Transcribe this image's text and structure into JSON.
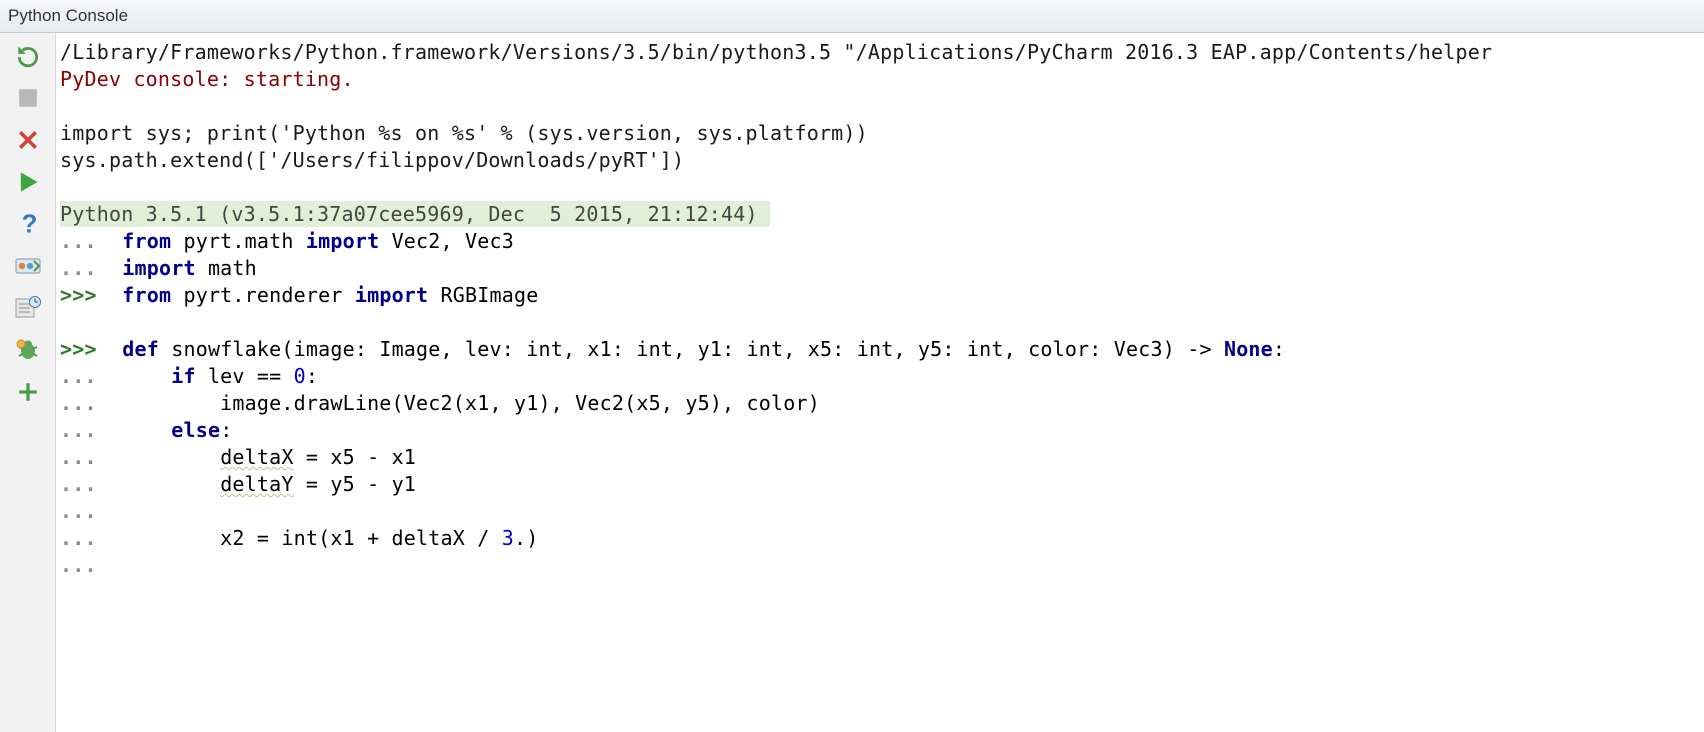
{
  "header": {
    "title": "Python Console"
  },
  "console": {
    "line1": "/Library/Frameworks/Python.framework/Versions/3.5/bin/python3.5 \"/Applications/PyCharm 2016.3 EAP.app/Contents/helper",
    "line2": "PyDev console: starting.",
    "line4": "import sys; print('Python %s on %s' % (sys.version, sys.platform))",
    "line5": "sys.path.extend(['/Users/filippov/Downloads/pyRT'])",
    "line7": "Python 3.5.1 (v3.5.1:37a07cee5969, Dec  5 2015, 21:12:44) ",
    "p_cont": "...",
    "p_main": ">>>",
    "kw_from": "from",
    "kw_import": "import",
    "kw_def": "def",
    "kw_if": "if",
    "kw_else": "else",
    "kw_None": "None",
    "txt_pyrt_math": " pyrt.math ",
    "txt_vec23": " Vec2, Vec3",
    "txt_math": " math",
    "txt_pyrt_renderer": " pyrt.renderer ",
    "txt_rgbimage": " RGBImage",
    "num_0": "0",
    "num_3": "3",
    "sig1": " snowflake(image: Image, lev: int, x1: int, y1: int, x5: int, y5: int, color: Vec3) -> ",
    "sig2": ":",
    "if_cond": " lev == ",
    "if_cond_end": ":",
    "draw": "        image.drawLine(Vec2(x1, y1), Vec2(x5, y5), color)",
    "else_colon": ":",
    "dx_pre": "        ",
    "dx_u": "deltaX",
    "dx_post": " = x5 - x1",
    "dy_pre": "        ",
    "dy_u": "deltaY",
    "dy_post": " = y5 - y1",
    "x2line": "        x2 = int(x1 + deltaX / ",
    "x2line_end": ".)",
    "ind1": "    ",
    "ind2": "        "
  }
}
